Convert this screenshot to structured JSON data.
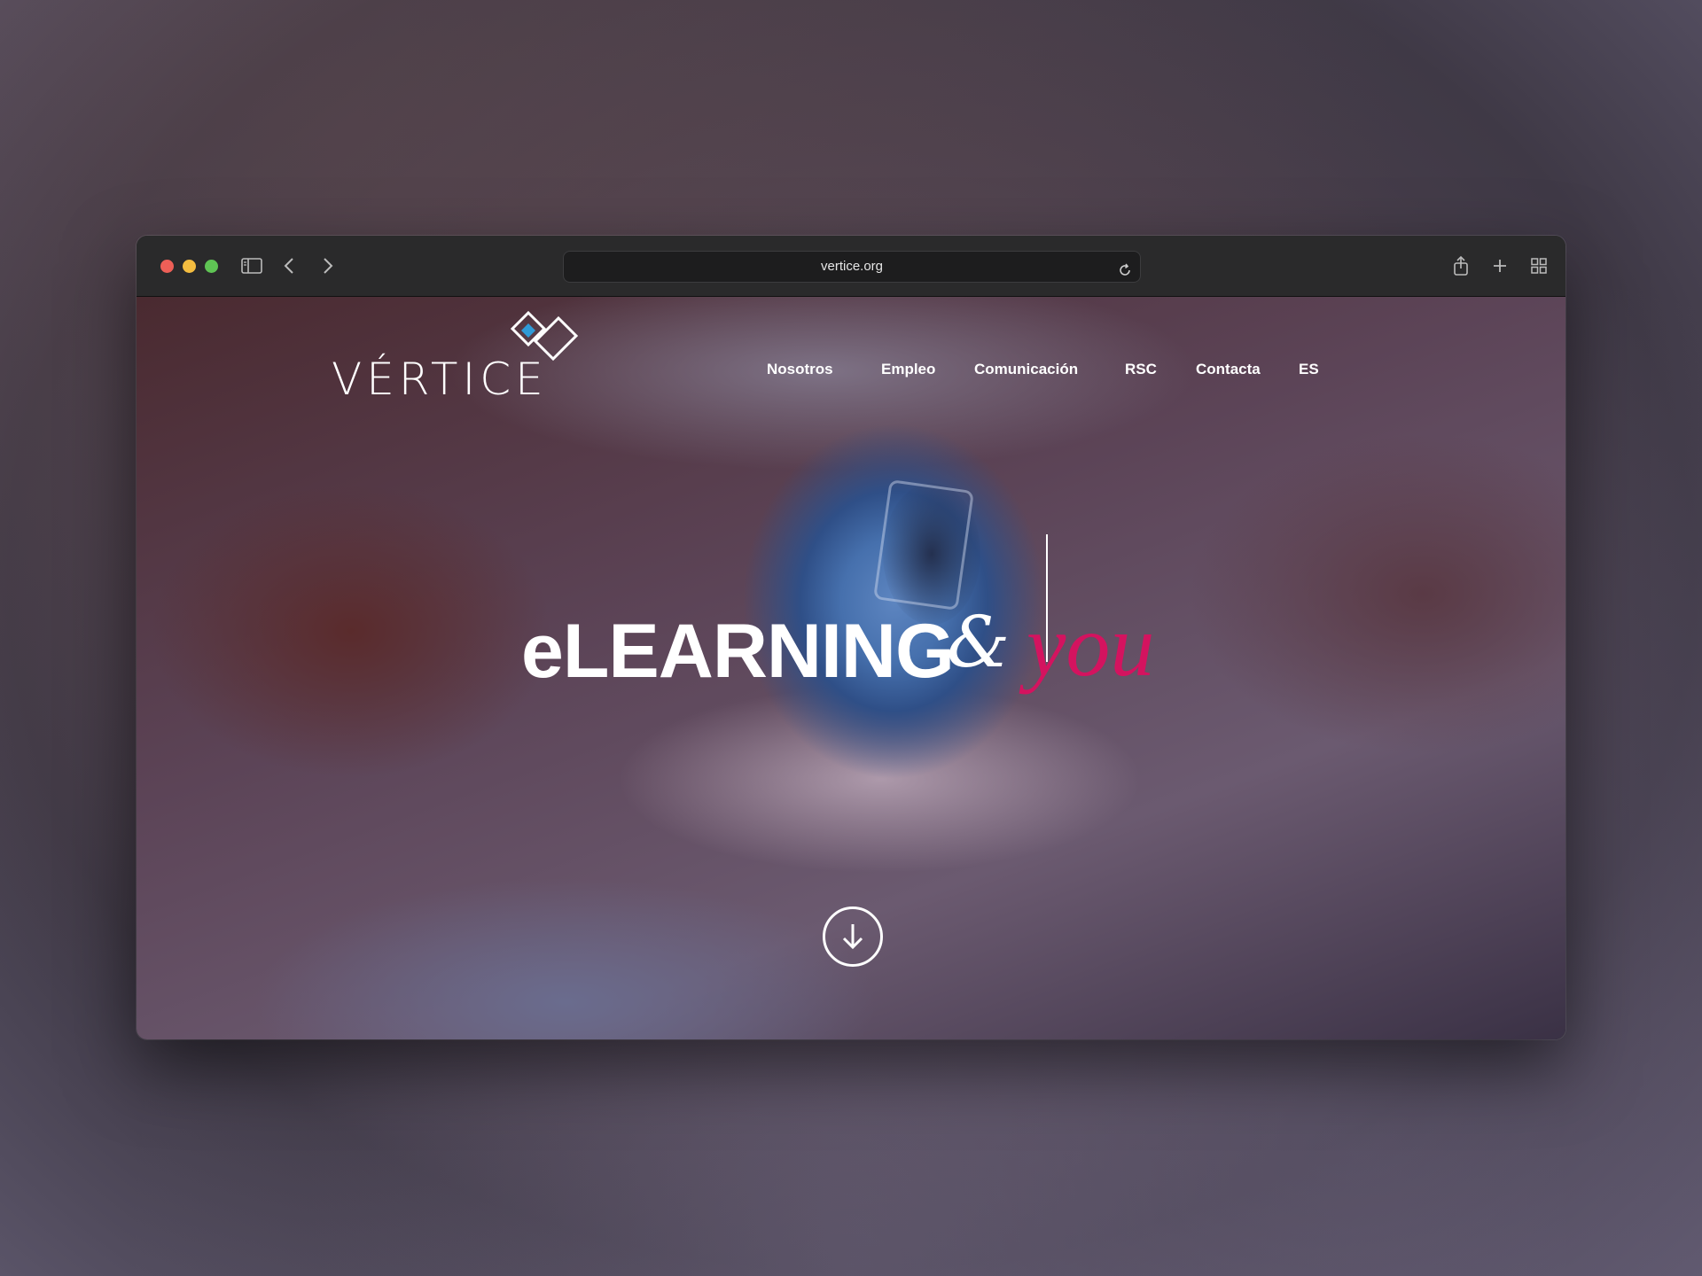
{
  "browser": {
    "url": "vertice.org",
    "icons": {
      "sidebar_toggle": "sidebar-icon",
      "back": "chevron-left-icon",
      "forward": "chevron-right-icon",
      "reload": "reload-icon",
      "share": "share-icon",
      "new_tab": "plus-icon",
      "tab_overview": "grid-icon"
    }
  },
  "site": {
    "brand": "VÉRTICE",
    "nav": [
      {
        "label": "Nosotros"
      },
      {
        "label": "Empleo"
      },
      {
        "label": "Comunicación"
      },
      {
        "label": "RSC"
      },
      {
        "label": "Contacta"
      },
      {
        "label": "ES"
      }
    ],
    "hero": {
      "main": "eLEARNING",
      "amp": "&",
      "accent": "you"
    },
    "scroll_icon": "arrow-down-circle-icon"
  },
  "colors": {
    "accent": "#d4135f",
    "text": "#ffffff",
    "logo_blue": "#2f9bd8"
  }
}
